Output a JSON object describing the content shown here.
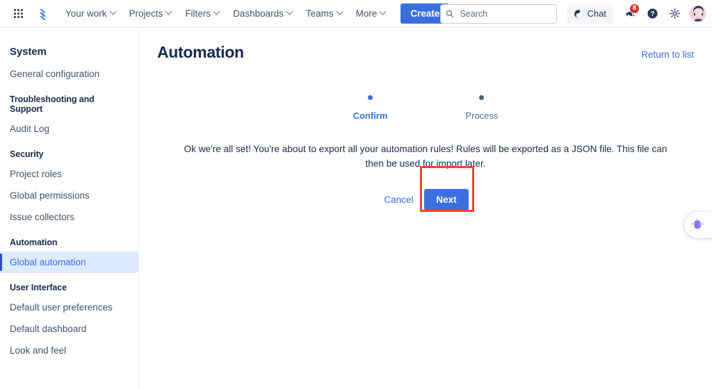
{
  "topnav": {
    "app_switcher_label": "app-switcher",
    "logo_label": "Jira",
    "items": [
      {
        "label": "Your work",
        "has_chevron": true
      },
      {
        "label": "Projects",
        "has_chevron": true
      },
      {
        "label": "Filters",
        "has_chevron": true
      },
      {
        "label": "Dashboards",
        "has_chevron": true
      },
      {
        "label": "Teams",
        "has_chevron": true
      },
      {
        "label": "More",
        "has_chevron": true
      }
    ],
    "create_label": "Create",
    "search": {
      "placeholder": "Search",
      "value": "",
      "icon": "search-icon"
    },
    "chat": {
      "label": "Chat",
      "icon": "chat-icon"
    },
    "notifications": {
      "icon": "notification-megaphone-icon",
      "badge_count": "8",
      "badge_color": "#c9372c"
    },
    "help": {
      "icon": "help-question-icon"
    },
    "settings": {
      "icon": "settings-gear-icon"
    },
    "profile": {
      "icon": "avatar"
    }
  },
  "sidebar": {
    "sections": [
      {
        "heading": "System",
        "heading_size": "big",
        "items": [
          {
            "label": "General configuration",
            "selected": false
          }
        ]
      },
      {
        "heading": "Troubleshooting and Support",
        "heading_size": "small",
        "items": [
          {
            "label": "Audit Log",
            "selected": false
          }
        ]
      },
      {
        "heading": "Security",
        "heading_size": "small",
        "items": [
          {
            "label": "Project roles",
            "selected": false
          },
          {
            "label": "Global permissions",
            "selected": false
          },
          {
            "label": "Issue collectors",
            "selected": false
          }
        ]
      },
      {
        "heading": "Automation",
        "heading_size": "small",
        "items": [
          {
            "label": "Global automation",
            "selected": true
          }
        ]
      },
      {
        "heading": "User Interface",
        "heading_size": "small",
        "items": [
          {
            "label": "Default user preferences",
            "selected": false
          },
          {
            "label": "Default dashboard",
            "selected": false
          },
          {
            "label": "Look and feel",
            "selected": false
          }
        ]
      }
    ]
  },
  "main": {
    "page_title": "Automation",
    "return_link": "Return to list",
    "stepper": [
      {
        "label": "Confirm",
        "active": true
      },
      {
        "label": "Process",
        "active": false
      }
    ],
    "body_text": "Ok we're all set! You're about to export all your automation rules! Rules will be exported as a JSON file. This file can then be used for import later.",
    "cancel_label": "Cancel",
    "next_label": "Next"
  },
  "annotation": {
    "highlight_target": "next-button",
    "color": "#f4422e"
  },
  "ai_widget": {
    "icon": "ai-assistant-icon",
    "color": "#8a7af0"
  },
  "colors": {
    "brand_blue": "#3b6fe0",
    "selected_bg": "#deebff",
    "text": "#172b4d",
    "muted_text": "#5e6c84",
    "badge_red": "#c9372c",
    "highlight_red": "#f4422e"
  }
}
